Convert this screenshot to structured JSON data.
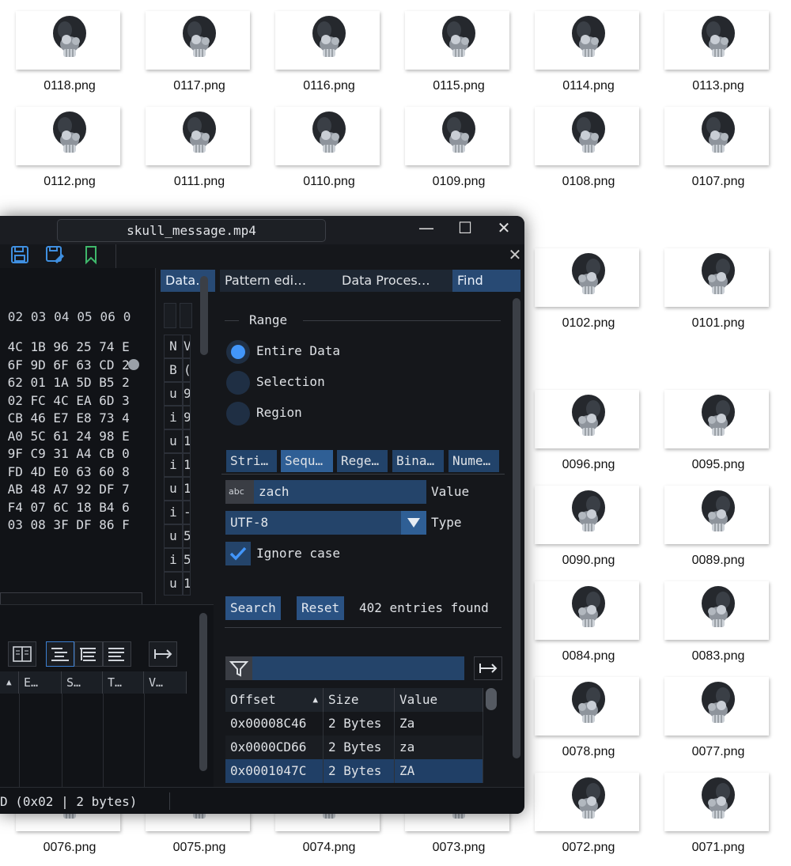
{
  "explorer": {
    "files": [
      {
        "name": "0118.png"
      },
      {
        "name": "0117.png"
      },
      {
        "name": "0116.png"
      },
      {
        "name": "0115.png"
      },
      {
        "name": "0114.png"
      },
      {
        "name": "0113.png"
      },
      {
        "name": "0112.png"
      },
      {
        "name": "0111.png"
      },
      {
        "name": "0110.png"
      },
      {
        "name": "0109.png"
      },
      {
        "name": "0108.png"
      },
      {
        "name": "0107.png"
      },
      {
        "name": "0102.png"
      },
      {
        "name": "0101.png"
      },
      {
        "name": "0096.png"
      },
      {
        "name": "0095.png"
      },
      {
        "name": "0090.png"
      },
      {
        "name": "0089.png"
      },
      {
        "name": "0084.png"
      },
      {
        "name": "0083.png"
      },
      {
        "name": "0078.png"
      },
      {
        "name": "0077.png"
      },
      {
        "name": "0076.png"
      },
      {
        "name": "0075.png"
      },
      {
        "name": "0074.png"
      },
      {
        "name": "0073.png"
      },
      {
        "name": "0072.png"
      },
      {
        "name": "0071.png"
      }
    ]
  },
  "window": {
    "title": "skull_message.mp4",
    "minimize_glyph": "—",
    "maximize_glyph": "☐",
    "close_glyph": "✕",
    "panel_close_glyph": "✕"
  },
  "toolbar": {
    "icons": [
      "save-icon",
      "save-as-icon",
      "bookmark-icon"
    ]
  },
  "hex": {
    "header": " 02 03 04 05 06 0",
    "rows": [
      " 4C 1B 96 25 74 E",
      " 6F 9D 6F 63 CD 2",
      " 62 01 1A 5D B5 2",
      " 02 FC 4C EA 6D 3",
      " CB 46 E7 E8 73 4",
      " A0 5C 61 24 98 E",
      " 9F C9 31 A4 CB 0",
      " FD 4D E0 63 60 8",
      " AB 48 A7 92 DF 7",
      " F4 07 6C 18 B4 6",
      " 03 08 3F DF 86 F"
    ]
  },
  "inspector": {
    "tab": "Data…",
    "cells": [
      [
        "N",
        "V"
      ],
      [
        "B",
        "("
      ],
      [
        "u",
        "9"
      ],
      [
        "i",
        "9"
      ],
      [
        "u",
        "1"
      ],
      [
        "i",
        "1"
      ],
      [
        "u",
        "1"
      ],
      [
        "i",
        "-"
      ],
      [
        "u",
        "5"
      ],
      [
        "i",
        "5"
      ],
      [
        "u",
        "1"
      ]
    ]
  },
  "bottom_left": {
    "columns": [
      "▲",
      "E…",
      "S…",
      "T…",
      "V…"
    ]
  },
  "tabs": {
    "pattern_editor": "Pattern edi…",
    "data_processor": "Data Proces…",
    "find": "Find"
  },
  "find": {
    "range_label": "Range",
    "range_options": [
      "Entire Data",
      "Selection",
      "Region"
    ],
    "range_selected": "Entire Data",
    "mode_tabs": [
      "Stri…",
      "Sequ…",
      "Rege…",
      "Bina…",
      "Nume…"
    ],
    "active_mode": "Sequ…",
    "value_icon": "abc",
    "value": "zach",
    "value_label": "Value",
    "type": "UTF-8",
    "type_label": "Type",
    "ignore_case_label": "Ignore case",
    "ignore_case": true,
    "search_button": "Search",
    "reset_button": "Reset",
    "results_count": "402 entries found",
    "filter_value": "",
    "table": {
      "headers": [
        "Offset",
        "Size",
        "Value"
      ],
      "rows": [
        {
          "offset": "0x00008C46",
          "size": "2 Bytes",
          "value": "Za"
        },
        {
          "offset": "0x0000CD66",
          "size": "2 Bytes",
          "value": "za"
        },
        {
          "offset": "0x0001047C",
          "size": "2 Bytes",
          "value": "ZA"
        }
      ],
      "selected_row": 2
    }
  },
  "status": {
    "text": "D (0x02 | 2 bytes)"
  },
  "colors": {
    "accent": "#4296fa",
    "tab_active": "#284a74",
    "window_bg": "#15171b"
  }
}
